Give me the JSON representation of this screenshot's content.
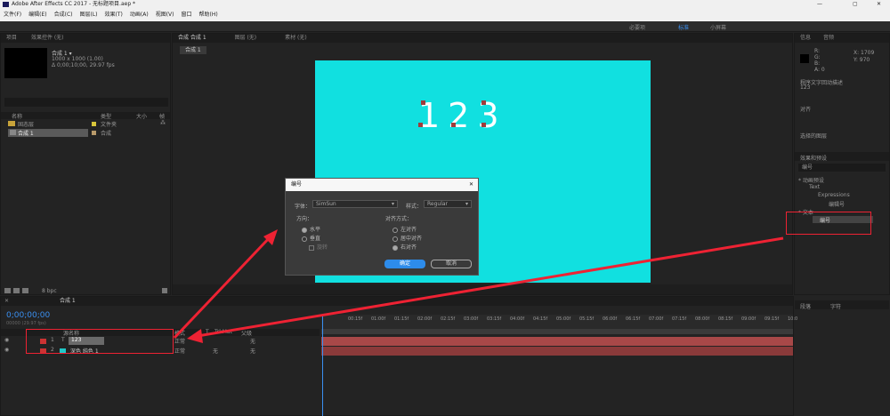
{
  "app": {
    "title": "Adobe After Effects CC 2017 - 无标题项目.aep *",
    "menu": [
      "文件(F)",
      "编辑(E)",
      "合成(C)",
      "图层(L)",
      "效果(T)",
      "动画(A)",
      "视图(V)",
      "窗口",
      "帮助(H)"
    ],
    "workspaces": [
      "必要项",
      "标准",
      "小屏幕"
    ]
  },
  "project": {
    "panel_label": "项目",
    "effects_label": "效果控件 (无)",
    "comp_name": "合成 1 ▾",
    "comp_info": [
      "1000 x 1000 (1.00)",
      "Δ 0;00;10;00, 29.97 fps"
    ],
    "columns": [
      "名称",
      "类型",
      "大小",
      "帧"
    ],
    "items": [
      {
        "name": "固态层",
        "type": "文件夹"
      },
      {
        "name": "合成 1",
        "type": "合成"
      }
    ],
    "bpc": "8 bpc"
  },
  "viewer": {
    "tabs": [
      "合成 合成 1",
      "图层 (无)",
      "素材 (无)"
    ],
    "subtab": "合成 1",
    "canvas_text": "123",
    "canvas_color": "#11e0e0"
  },
  "dialog": {
    "title": "编号",
    "font_label": "字体：",
    "font_value": "SimSun",
    "style_label": "样式：",
    "style_value": "Regular",
    "direction_label": "方向：",
    "horizontal": "水平",
    "vertical": "垂直",
    "rotate": "旋转",
    "align_label": "对齐方式：",
    "align_left": "左对齐",
    "align_center": "居中对齐",
    "align_right": "右对齐",
    "ok": "确定",
    "cancel": "取消"
  },
  "right": {
    "info_tabs": [
      "信息",
      "音频"
    ],
    "coords": [
      "X: 1709",
      "Y: 970"
    ],
    "rgb": [
      "R:",
      "G:",
      "B:",
      "A: 0"
    ],
    "info_text": "程序文字回动描述",
    "info_sub": "123",
    "align_label": "对齐",
    "layer_label": "选择的图层",
    "presets_tab": "效果和预设",
    "search_value": "编号",
    "tree": [
      "* 动画预设",
      "Text",
      "Expressions",
      "编辑号",
      "* 文本",
      "编号"
    ],
    "lower_tabs": [
      "段落",
      "字符"
    ]
  },
  "timeline": {
    "tab": "合成 1",
    "timecode": "0;00;00;00",
    "fps_text": "00000 (29.97 fps)",
    "columns": [
      "源名称",
      "模式",
      "T",
      "TrkMat",
      "父级"
    ],
    "ruler": [
      "00:15f",
      "01:00f",
      "01:15f",
      "02:00f",
      "02:15f",
      "03:00f",
      "03:15f",
      "04:00f",
      "04:15f",
      "05:00f",
      "05:15f",
      "06:00f",
      "06:15f",
      "07:00f",
      "07:15f",
      "08:00f",
      "08:15f",
      "09:00f",
      "09:15f",
      "10:0"
    ],
    "layers": [
      {
        "num": "1",
        "name": "123",
        "mode": "正常",
        "parent": "无"
      },
      {
        "num": "2",
        "name": "深色 纯色 1",
        "mode": "正常",
        "trkmat": "无",
        "parent": "无"
      }
    ]
  }
}
